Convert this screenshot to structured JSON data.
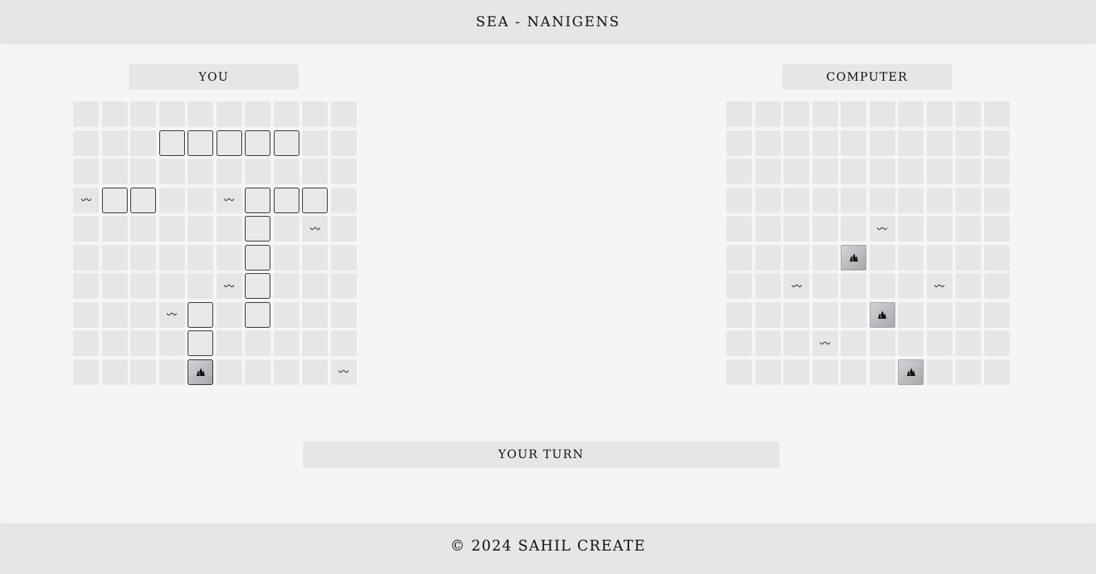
{
  "header": {
    "title": "SEA - NANIGENS"
  },
  "player": {
    "label": "YOU",
    "rows": [
      "..........",
      "...SSSSS..",
      "..........",
      "MSS..MSSS.",
      "......S.M.",
      "......S...",
      ".....MS...",
      "...MS.S...",
      "....S.....",
      "....X....M"
    ]
  },
  "computer": {
    "label": "COMPUTER",
    "rows": [
      "..........",
      "..........",
      "..........",
      "..........",
      ".....M....",
      "....H.....",
      "..M....M..",
      ".....H....",
      "...M......",
      "......H..."
    ]
  },
  "legend": {
    "S": "ship",
    "M": "miss",
    "H": "hit",
    "X": "hit-ship",
    "miss_icon": "wave-icon",
    "hit_icon": "fire-icon"
  },
  "status": {
    "turn_label": "YOUR TURN"
  },
  "footer": {
    "text": "© 2024 SAHIL CREATE"
  }
}
